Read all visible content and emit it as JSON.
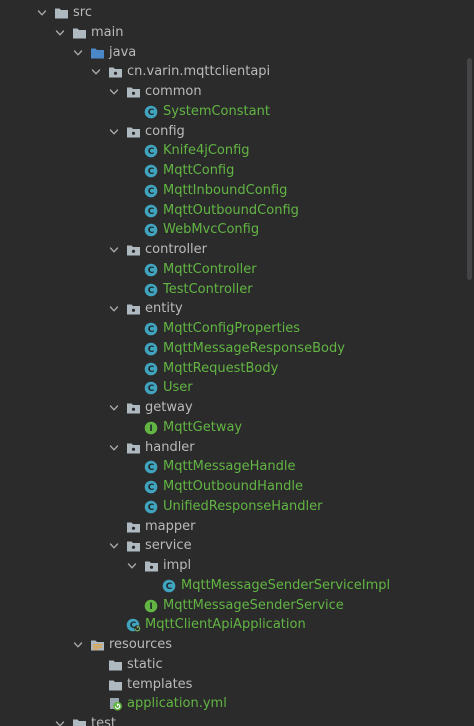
{
  "project_tree": {
    "items": [
      {
        "label": "src",
        "kind": "folder",
        "depth": 0,
        "expanded": true,
        "icon": "folder-icon"
      },
      {
        "label": "main",
        "kind": "folder",
        "depth": 1,
        "expanded": true,
        "icon": "folder-icon"
      },
      {
        "label": "java",
        "kind": "source-folder",
        "depth": 2,
        "expanded": true,
        "icon": "source-root-folder-icon"
      },
      {
        "label": "cn.varin.mqttclientapi",
        "kind": "package",
        "depth": 3,
        "expanded": true,
        "icon": "package-icon"
      },
      {
        "label": "common",
        "kind": "package",
        "depth": 4,
        "expanded": true,
        "icon": "package-icon"
      },
      {
        "label": "SystemConstant",
        "kind": "class",
        "depth": 5,
        "icon": "java-class-icon"
      },
      {
        "label": "config",
        "kind": "package",
        "depth": 4,
        "expanded": true,
        "icon": "package-icon"
      },
      {
        "label": "Knife4jConfig",
        "kind": "class",
        "depth": 5,
        "icon": "java-class-icon"
      },
      {
        "label": "MqttConfig",
        "kind": "class",
        "depth": 5,
        "icon": "java-class-icon"
      },
      {
        "label": "MqttInboundConfig",
        "kind": "class",
        "depth": 5,
        "icon": "java-class-icon"
      },
      {
        "label": "MqttOutboundConfig",
        "kind": "class",
        "depth": 5,
        "icon": "java-class-icon"
      },
      {
        "label": "WebMvcConfig",
        "kind": "class",
        "depth": 5,
        "icon": "java-class-icon"
      },
      {
        "label": "controller",
        "kind": "package",
        "depth": 4,
        "expanded": true,
        "icon": "package-icon"
      },
      {
        "label": "MqttController",
        "kind": "class",
        "depth": 5,
        "icon": "java-class-icon"
      },
      {
        "label": "TestController",
        "kind": "class",
        "depth": 5,
        "icon": "java-class-icon"
      },
      {
        "label": "entity",
        "kind": "package",
        "depth": 4,
        "expanded": true,
        "icon": "package-icon"
      },
      {
        "label": "MqttConfigProperties",
        "kind": "class",
        "depth": 5,
        "icon": "java-class-icon"
      },
      {
        "label": "MqttMessageResponseBody",
        "kind": "class",
        "depth": 5,
        "icon": "java-class-icon"
      },
      {
        "label": "MqttRequestBody",
        "kind": "class",
        "depth": 5,
        "icon": "java-class-icon"
      },
      {
        "label": "User",
        "kind": "class",
        "depth": 5,
        "icon": "java-class-icon"
      },
      {
        "label": "getway",
        "kind": "package",
        "depth": 4,
        "expanded": true,
        "icon": "package-icon"
      },
      {
        "label": "MqttGetway",
        "kind": "interface",
        "depth": 5,
        "icon": "java-interface-icon"
      },
      {
        "label": "handler",
        "kind": "package",
        "depth": 4,
        "expanded": true,
        "icon": "package-icon"
      },
      {
        "label": "MqttMessageHandle",
        "kind": "class",
        "depth": 5,
        "icon": "java-class-icon"
      },
      {
        "label": "MqttOutboundHandle",
        "kind": "class",
        "depth": 5,
        "icon": "java-class-icon"
      },
      {
        "label": "UnifiedResponseHandler",
        "kind": "class",
        "depth": 5,
        "icon": "java-class-icon"
      },
      {
        "label": "mapper",
        "kind": "package",
        "depth": 4,
        "expanded": false,
        "leaf": true,
        "icon": "package-icon"
      },
      {
        "label": "service",
        "kind": "package",
        "depth": 4,
        "expanded": true,
        "icon": "package-icon"
      },
      {
        "label": "impl",
        "kind": "package",
        "depth": 5,
        "expanded": true,
        "icon": "package-icon"
      },
      {
        "label": "MqttMessageSenderServiceImpl",
        "kind": "class",
        "depth": 6,
        "icon": "java-class-icon"
      },
      {
        "label": "MqttMessageSenderService",
        "kind": "interface",
        "depth": 5,
        "icon": "java-interface-icon"
      },
      {
        "label": "MqttClientApiApplication",
        "kind": "spring-class",
        "depth": 4,
        "icon": "spring-boot-class-icon"
      },
      {
        "label": "resources",
        "kind": "resources-folder",
        "depth": 2,
        "expanded": true,
        "icon": "resources-root-folder-icon"
      },
      {
        "label": "static",
        "kind": "folder",
        "depth": 3,
        "leaf": true,
        "icon": "folder-icon"
      },
      {
        "label": "templates",
        "kind": "folder",
        "depth": 3,
        "leaf": true,
        "icon": "folder-icon"
      },
      {
        "label": "application.yml",
        "kind": "yml",
        "depth": 3,
        "icon": "yaml-spring-file-icon"
      },
      {
        "label": "test",
        "kind": "folder",
        "depth": 1,
        "expanded": true,
        "icon": "folder-icon"
      }
    ]
  },
  "colors": {
    "background": "#2b2b2b",
    "text_default": "#bababa",
    "text_class": "#62b543",
    "folder": "#aeb9c0",
    "source_root": "#4a88c7",
    "class_circle": "#40a4bf",
    "interface_circle": "#62b543",
    "arrow": "#a9a9a9"
  }
}
